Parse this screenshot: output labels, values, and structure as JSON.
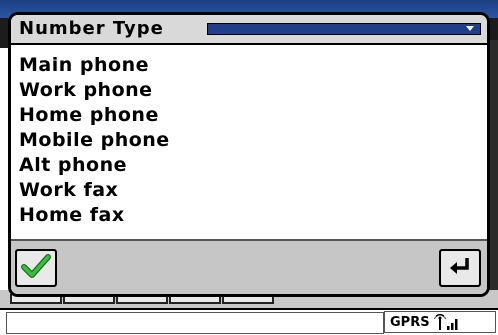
{
  "popup": {
    "title": "Number Type",
    "options": [
      "Main phone",
      "Work phone",
      "Home phone",
      "Mobile phone",
      "Alt phone",
      "Work fax",
      "Home fax"
    ],
    "ok_icon": "checkmark-icon",
    "back_icon": "back-arrow-icon",
    "dropdown_icon": "dropdown-arrow-icon"
  },
  "status_bar": {
    "network_label": "GPRS",
    "signal_icon": "signal-strength-icon"
  },
  "colors": {
    "title_bar_blue": "#1f3f8a",
    "checkmark_green": "#2fa12f"
  }
}
